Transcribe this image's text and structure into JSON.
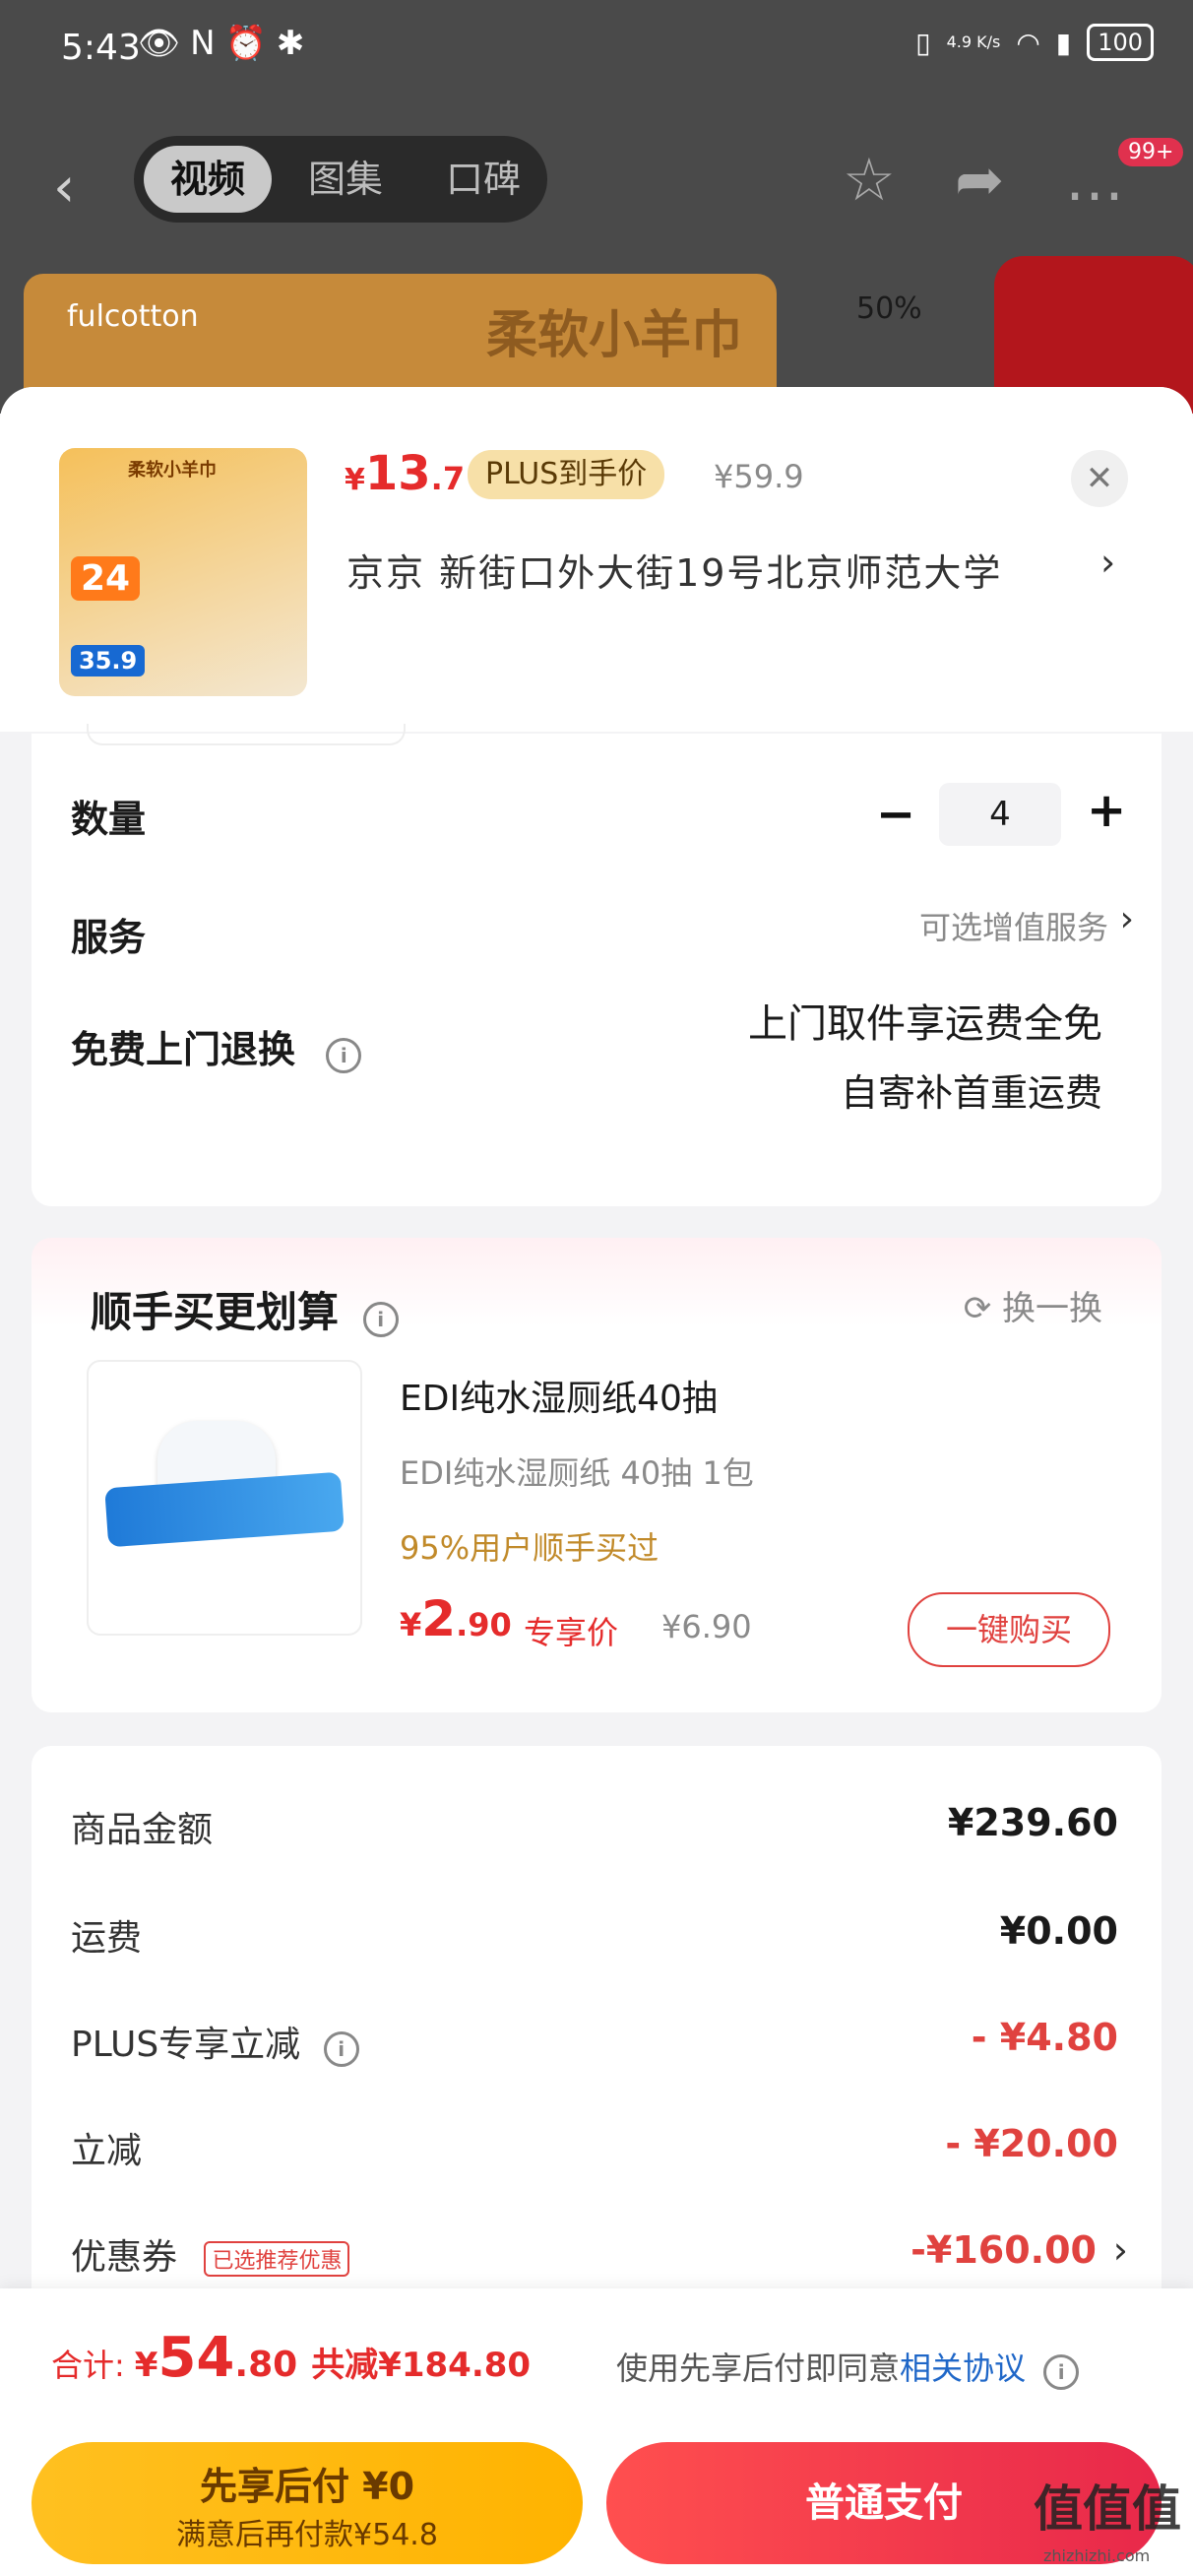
{
  "status_bar": {
    "time": "5:43",
    "net_speed": "4.9\nK/s",
    "battery": "100"
  },
  "nav": {
    "tabs": [
      {
        "label": "视频"
      },
      {
        "label": "图集"
      },
      {
        "label": "口碑"
      }
    ],
    "badge": "99+"
  },
  "background": {
    "banner_title": "柔软小羊巾",
    "banner_brand": "fulcotton",
    "promo_text": "50%"
  },
  "product": {
    "thumb_title": "柔软小羊巾",
    "thumb_badge": "24",
    "thumb_price": "35.9",
    "price_currency": "¥",
    "price_int": "13",
    "price_dec": ".7",
    "plus_tag": "PLUS到手价",
    "old_price": "¥59.9",
    "address": "京京   新街口外大街19号北京师范大学"
  },
  "options": {
    "qty_label": "数量",
    "qty_value": "4",
    "service_label": "服务",
    "service_hint": "可选增值服务",
    "return_label": "免费上门退换",
    "return_line1": "上门取件享运费全免",
    "return_line2": "自寄补首重运费"
  },
  "addon": {
    "title": "顺手买更划算",
    "refresh_label": "换一换",
    "name": "EDI纯水湿厕纸40抽",
    "spec": "EDI纯水湿厕纸 40抽 1包",
    "social": "95%用户顺手买过",
    "price_currency": "¥",
    "price_int": "2",
    "price_dec": ".90",
    "exclusive_label": "专享价",
    "old_price": "¥6.90",
    "buy_label": "一键购买"
  },
  "summary": {
    "rows": [
      {
        "label": "商品金额",
        "value": "¥239.60"
      },
      {
        "label": "运费",
        "value": "¥0.00"
      },
      {
        "label": "PLUS专享立减",
        "value": "- ¥4.80"
      },
      {
        "label": "立减",
        "value": "- ¥20.00"
      },
      {
        "label": "优惠券",
        "value": "-¥160.00",
        "tag": "已选推荐优惠"
      }
    ]
  },
  "footer": {
    "total_label": "合计:",
    "total_currency": "¥",
    "total_int": "54",
    "total_dec": ".80",
    "saved": "共减¥184.80",
    "agree_text": "使用先享后付即同意",
    "agree_link": "相关协议",
    "pay_later_title": "先享后付 ¥0",
    "pay_later_sub": "满意后再付款¥54.8",
    "pay_normal": "普通支付",
    "watermark": "值值值",
    "watermark_sub": "zhizhizhi.com"
  },
  "colors": {
    "price_red": "#e52b2b",
    "accent_gold": "#ffb300",
    "link_blue": "#1f67c8"
  }
}
